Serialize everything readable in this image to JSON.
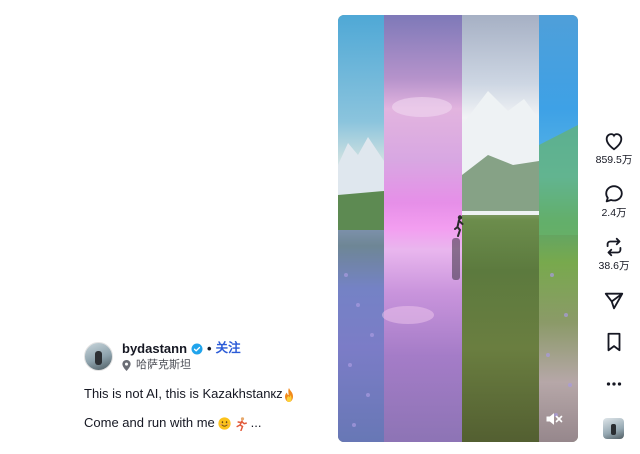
{
  "author": {
    "username": "bydastann",
    "separator": "•",
    "follow_label": "关注",
    "location": "哈萨克斯坦"
  },
  "caption": {
    "line1": "This is not AI, this is Kazakhstanкz",
    "line2": "Come and run with me",
    "line2_suffix": "..."
  },
  "actions": {
    "likes": "859.5万",
    "comments": "2.4万",
    "shares": "38.6万"
  },
  "icons": {
    "verified": "verified-badge-icon",
    "location": "location-pin-icon",
    "like": "heart-icon",
    "comment": "comment-bubble-icon",
    "share": "repost-arrows-icon",
    "send": "send-paper-plane-icon",
    "save": "bookmark-icon",
    "more": "more-dots-icon",
    "mute": "muted-speaker-icon"
  },
  "colors": {
    "follow": "#2b5bd7",
    "verified": "#20d5ec",
    "text": "#161823"
  }
}
